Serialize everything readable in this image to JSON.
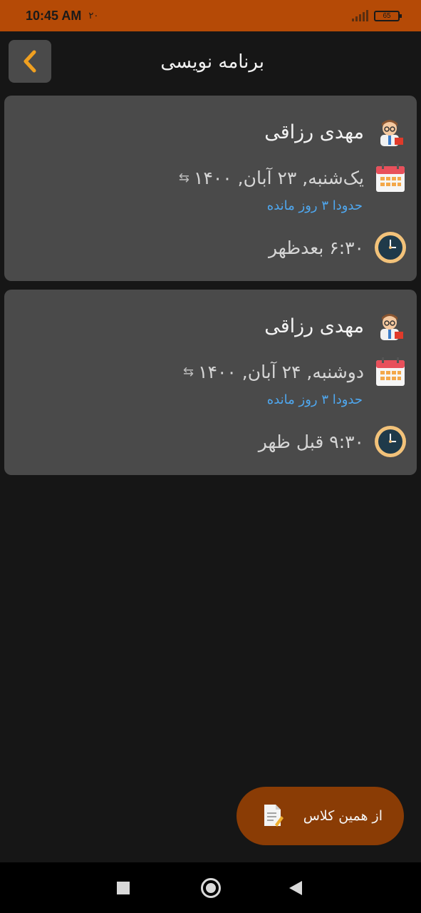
{
  "status_bar": {
    "time": "10:45 AM",
    "notification": "۲۰",
    "battery": "65"
  },
  "header": {
    "title": "برنامه نویسی",
    "back_icon": "chevron-left-icon",
    "accent_color": "#f0a020"
  },
  "sessions": [
    {
      "teacher": "مهدی رزاقی",
      "date": "یک‌شنبه, ۲۳ آبان, ۱۴۰۰",
      "remaining": "حدودا ۳ روز مانده",
      "time": "۶:۳۰ بعدظهر"
    },
    {
      "teacher": "مهدی رزاقی",
      "date": "دوشنبه, ۲۴ آبان, ۱۴۰۰",
      "remaining": "حدودا ۳ روز مانده",
      "time": "۹:۳۰ قبل ظهر"
    }
  ],
  "fab": {
    "label": "از همین کلاس",
    "icon": "document-edit-icon"
  },
  "colors": {
    "status_bar": "#b54a06",
    "background": "#161616",
    "card": "#4a4a4a",
    "fab": "#8a3c05",
    "link": "#4fa8f0"
  }
}
